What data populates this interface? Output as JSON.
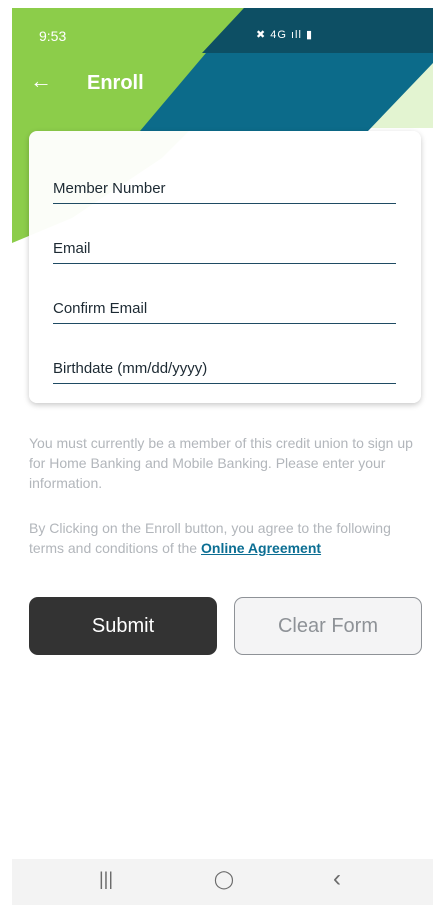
{
  "status_bar": {
    "time": "9:53",
    "icons": "✖ 4G ıll ▮"
  },
  "appbar": {
    "back_icon": "arrow-left-icon",
    "title": "Enroll"
  },
  "form": {
    "fields": [
      {
        "placeholder": "Member Number",
        "value": ""
      },
      {
        "placeholder": "Email",
        "value": ""
      },
      {
        "placeholder": "Confirm Email",
        "value": ""
      },
      {
        "placeholder": "Birthdate (mm/dd/yyyy)",
        "value": ""
      }
    ]
  },
  "info": {
    "membership_text": "You must currently be a member of this credit union to sign up for Home Banking and Mobile Banking. Please enter your information.",
    "terms_text": "By Clicking on the Enroll button, you agree to the following terms and conditions of the ",
    "terms_link": "Online Agreement"
  },
  "buttons": {
    "submit": "Submit",
    "clear": "Clear Form"
  },
  "navbar": {
    "recents": "|||",
    "home": "◯",
    "back": "‹"
  },
  "colors": {
    "green": "#8ccd4a",
    "teal": "#0c6b8a",
    "dark_teal": "#0d4f64",
    "light_green": "#e6f5d6"
  }
}
